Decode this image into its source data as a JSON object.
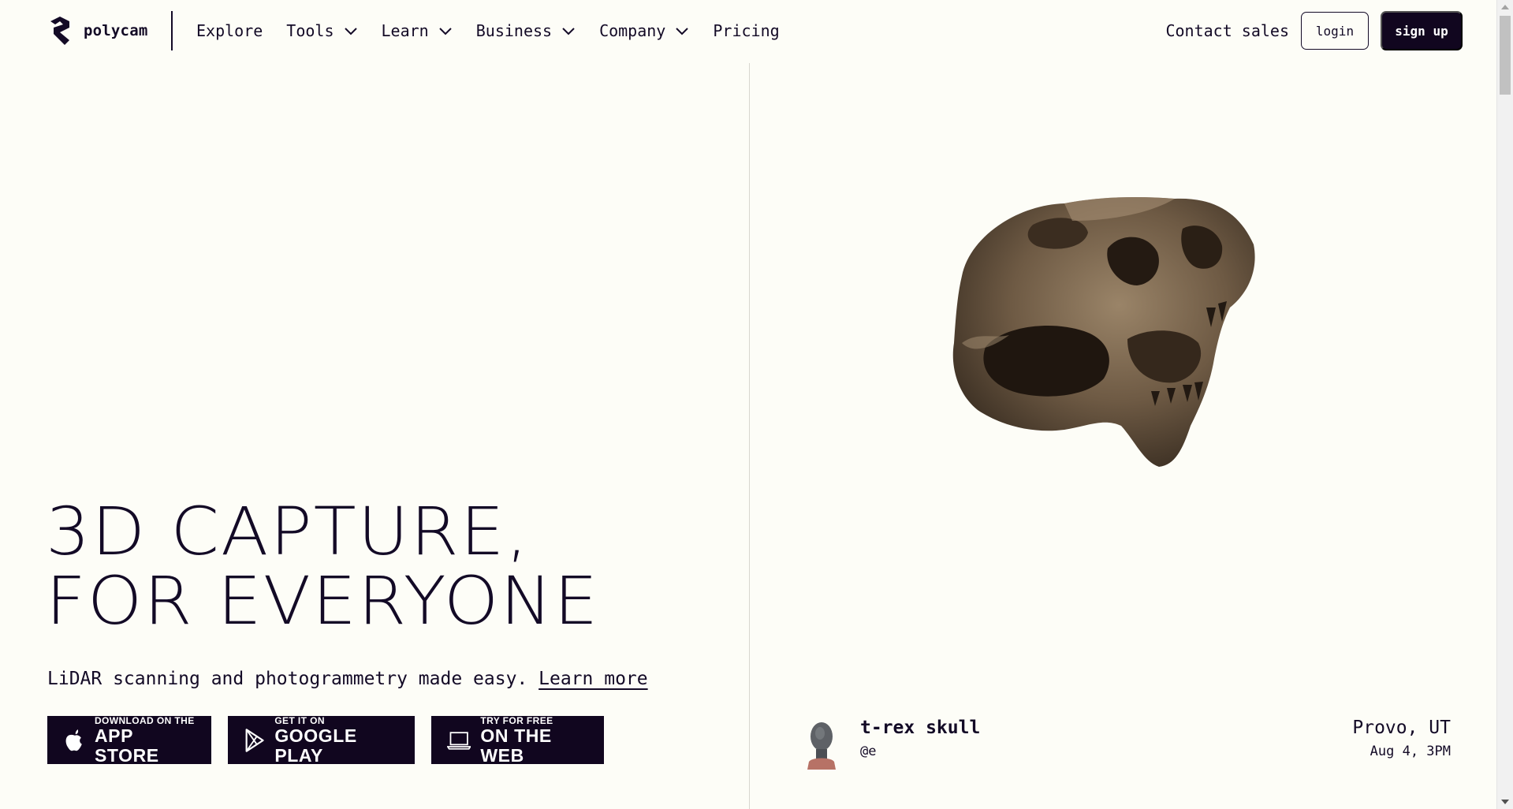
{
  "brand": {
    "name": "polycam",
    "accent_color": "#130a26"
  },
  "nav": {
    "items": [
      {
        "label": "Explore",
        "has_dropdown": false
      },
      {
        "label": "Tools",
        "has_dropdown": true
      },
      {
        "label": "Learn",
        "has_dropdown": true
      },
      {
        "label": "Business",
        "has_dropdown": true
      },
      {
        "label": "Company",
        "has_dropdown": true
      },
      {
        "label": "Pricing",
        "has_dropdown": false
      }
    ],
    "contact_label": "Contact sales",
    "login_label": "login",
    "signup_label": "sign up"
  },
  "hero": {
    "title_line1": "3D CAPTURE,",
    "title_line2": "FOR EVERYONE",
    "subtitle": "LiDAR scanning and photogrammetry made easy.",
    "learn_more": "Learn more"
  },
  "stores": [
    {
      "small": "DOWNLOAD ON THE",
      "big": "APP STORE",
      "icon": "apple-icon"
    },
    {
      "small": "GET IT ON",
      "big": "GOOGLE PLAY",
      "icon": "google-play-icon"
    },
    {
      "small": "TRY FOR FREE",
      "big": "ON THE WEB",
      "icon": "laptop-icon"
    }
  ],
  "featured_model": {
    "name": "t-rex skull",
    "author": "@e",
    "location": "Provo, UT",
    "date": "Aug 4, 3PM",
    "avatar_icon": "bust-avatar-icon",
    "model_icon": "t-rex-skull-icon"
  }
}
